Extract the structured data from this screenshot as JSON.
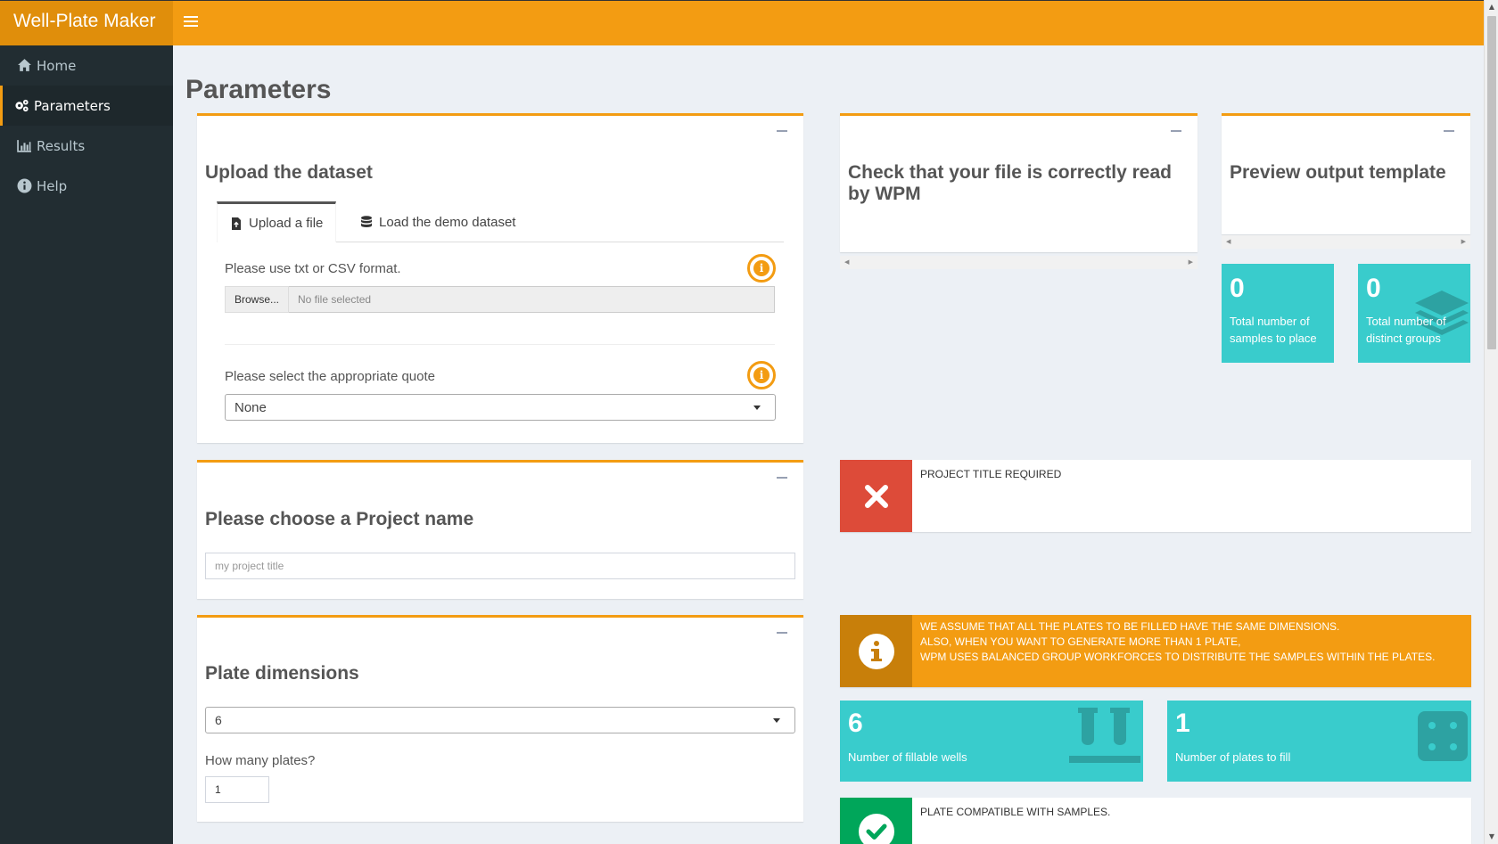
{
  "app": {
    "title": "Well-Plate Maker"
  },
  "sidebar": {
    "items": [
      {
        "label": "Home",
        "icon": "home-icon"
      },
      {
        "label": "Parameters",
        "icon": "cogs-icon",
        "active": true
      },
      {
        "label": "Results",
        "icon": "bar-chart-icon"
      },
      {
        "label": "Help",
        "icon": "info-circle-icon"
      }
    ]
  },
  "page": {
    "title": "Parameters"
  },
  "upload": {
    "title": "Upload the dataset",
    "tabs": [
      "Upload a file",
      "Load the demo dataset"
    ],
    "format_hint": "Please use txt or CSV format.",
    "browse_label": "Browse...",
    "file_placeholder": "No file selected",
    "quote_label": "Please select the appropriate quote",
    "quote_value": "None"
  },
  "check": {
    "title": "Check that your file is correctly read by WPM"
  },
  "preview": {
    "title": "Preview output template"
  },
  "stats": {
    "samples": {
      "value": "0",
      "caption_line1": "Total number of",
      "caption_line2": "samples to place"
    },
    "groups": {
      "value": "0",
      "caption_line1": "Total number of",
      "caption_line2": "distinct groups"
    }
  },
  "project": {
    "title": "Please choose a Project name",
    "placeholder": "my project title",
    "status": "PROJECT TITLE REQUIRED"
  },
  "plate": {
    "title": "Plate dimensions",
    "dimension_value": "6",
    "how_many_label": "How many plates?",
    "how_many_value": "1",
    "notice_line1": "WE ASSUME THAT ALL THE PLATES TO BE FILLED HAVE THE SAME DIMENSIONS.",
    "notice_line2": "ALSO, WHEN YOU WANT TO GENERATE MORE THAN 1 PLATE,",
    "notice_line3": "WPM USES BALANCED GROUP WORKFORCES TO DISTRIBUTE THE SAMPLES WITHIN THE PLATES.",
    "fillable_wells": {
      "value": "6",
      "caption": "Number of fillable wells"
    },
    "plates_to_fill": {
      "value": "1",
      "caption": "Number of plates to fill"
    },
    "compatible_status": "PLATE COMPATIBLE WITH SAMPLES."
  },
  "colors": {
    "accent": "#f39c12",
    "teal": "#39cccc",
    "danger": "#dd4b39",
    "success": "#00a65a",
    "sidebar": "#222d32"
  }
}
